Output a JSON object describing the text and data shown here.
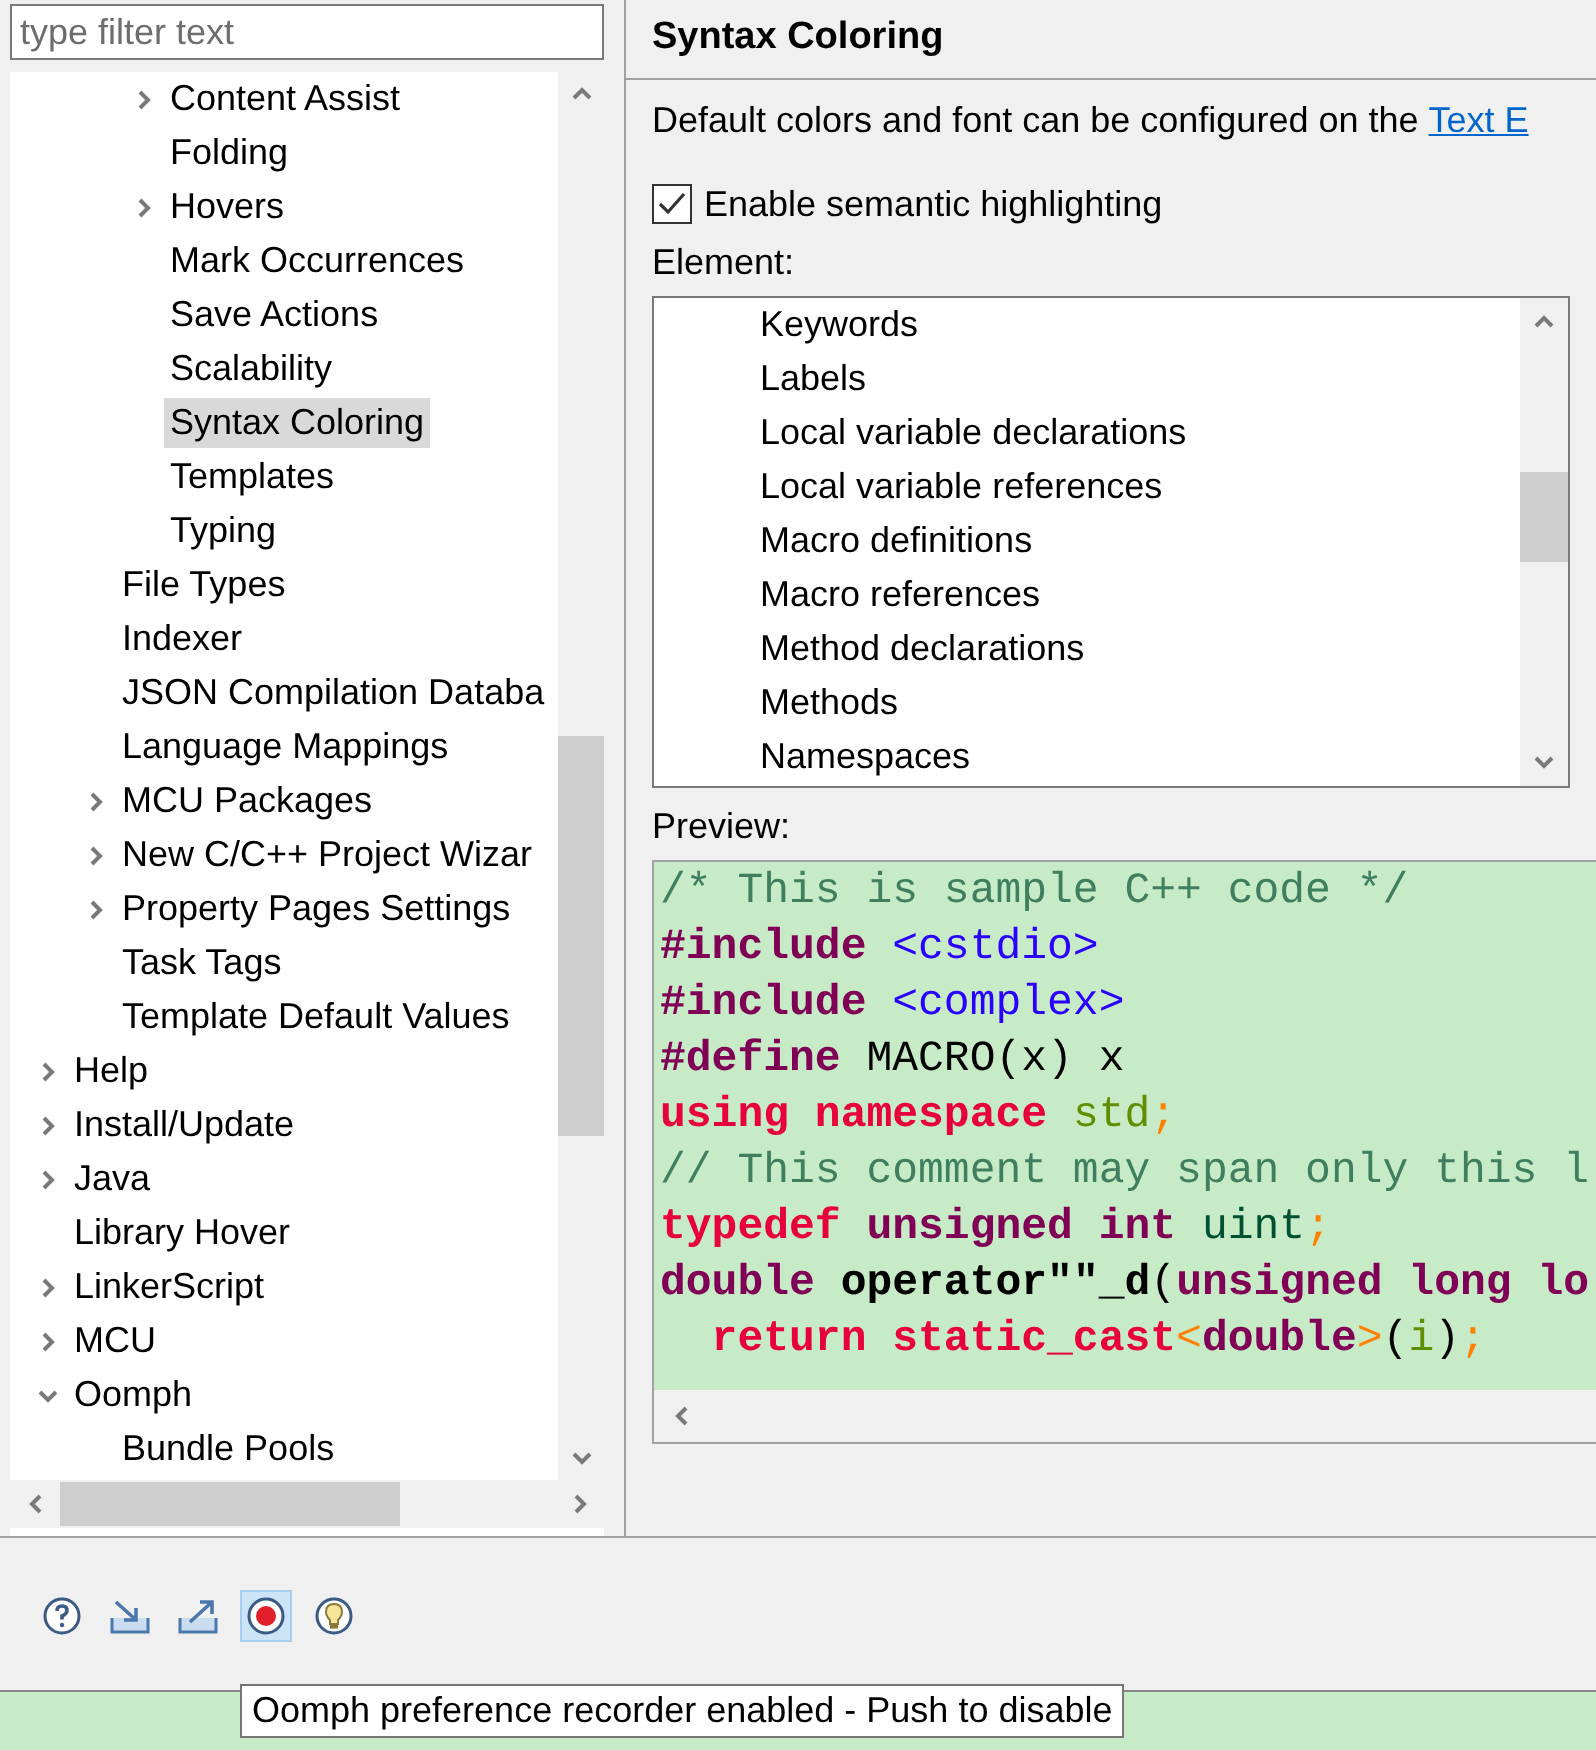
{
  "filter": {
    "placeholder": "type filter text"
  },
  "tree": [
    {
      "children": [
        {
          "children": [
            {
              "label": "Content Assist",
              "expanded": false,
              "selected": false
            },
            {
              "label": "Folding",
              "selected": false
            },
            {
              "label": "Hovers",
              "expanded": false,
              "selected": false
            },
            {
              "label": "Mark Occurrences",
              "selected": false
            },
            {
              "label": "Save Actions",
              "selected": false
            },
            {
              "label": "Scalability",
              "selected": false
            },
            {
              "label": "Syntax Coloring",
              "selected": true
            },
            {
              "label": "Templates",
              "selected": false
            },
            {
              "label": "Typing",
              "selected": false
            }
          ]
        },
        {
          "label": "File Types",
          "selected": false
        },
        {
          "label": "Indexer",
          "selected": false
        },
        {
          "label": "JSON Compilation Databa",
          "selected": false
        },
        {
          "label": "Language Mappings",
          "selected": false
        },
        {
          "label": "MCU Packages",
          "expanded": false,
          "selected": false
        },
        {
          "label": "New C/C++ Project Wizar",
          "expanded": false,
          "selected": false
        },
        {
          "label": "Property Pages Settings",
          "expanded": false,
          "selected": false
        },
        {
          "label": "Task Tags",
          "selected": false
        },
        {
          "label": "Template Default Values",
          "selected": false
        }
      ]
    },
    {
      "label": "Help",
      "expanded": false,
      "selected": false
    },
    {
      "label": "Install/Update",
      "expanded": false,
      "selected": false
    },
    {
      "label": "Java",
      "expanded": false,
      "selected": false
    },
    {
      "label": "Library Hover",
      "selected": false
    },
    {
      "label": "LinkerScript",
      "expanded": false,
      "selected": false
    },
    {
      "label": "MCU",
      "expanded": false,
      "selected": false
    },
    {
      "label": "Oomph",
      "expanded": true,
      "selected": false,
      "children": [
        {
          "label": "Bundle Pools",
          "selected": false
        }
      ]
    }
  ],
  "page": {
    "title": "Syntax Coloring",
    "description": "Default colors and font can be configured on the",
    "link": "Text E",
    "semantic": {
      "label": "Enable semantic highlighting",
      "checked": true
    },
    "element_label": "Element:",
    "elements": [
      {
        "label": "Keywords"
      },
      {
        "label": "Labels"
      },
      {
        "label": "Local variable declarations"
      },
      {
        "label": "Local variable references"
      },
      {
        "label": "Macro definitions"
      },
      {
        "label": "Macro references"
      },
      {
        "label": "Method declarations"
      },
      {
        "label": "Methods"
      },
      {
        "label": "Namespaces"
      }
    ],
    "preview_label": "Preview:",
    "preview": [
      [
        {
          "t": "/* This is sample C++ code */",
          "kind": "comment"
        }
      ],
      [
        {
          "t": "#include",
          "kind": "directive"
        },
        {
          "t": " <cstdio>",
          "kind": "string"
        }
      ],
      [
        {
          "t": "#include",
          "kind": "directive"
        },
        {
          "t": " <complex>",
          "kind": "string"
        }
      ],
      [
        {
          "t": "#define",
          "kind": "directive"
        },
        {
          "t": " MACRO(x) x",
          "kind": "plain"
        }
      ],
      [
        {
          "t": "using namespace",
          "kind": "keyword"
        },
        {
          "t": " std",
          "kind": "name"
        },
        {
          "t": ";",
          "kind": "operator"
        }
      ],
      [
        {
          "t": "// This comment may span only this l",
          "kind": "comment"
        }
      ],
      [
        {
          "t": "typedef",
          "kind": "keyword"
        },
        {
          "t": " unsigned int",
          "kind": "type"
        },
        {
          "t": " uint",
          "kind": "typedef"
        },
        {
          "t": ";",
          "kind": "operator"
        }
      ],
      [
        {
          "t": "double",
          "kind": "type"
        },
        {
          "t": " operator\"\"_d",
          "kind": "function"
        },
        {
          "t": "(",
          "kind": "plain"
        },
        {
          "t": "unsigned long lo",
          "kind": "type"
        }
      ],
      [
        {
          "t": "  return",
          "kind": "keyword"
        },
        {
          "t": " static_cast",
          "kind": "keyword"
        },
        {
          "t": "<",
          "kind": "operator"
        },
        {
          "t": "double",
          "kind": "type"
        },
        {
          "t": ">",
          "kind": "operator"
        },
        {
          "t": "(",
          "kind": "plain"
        },
        {
          "t": "i",
          "kind": "name"
        },
        {
          "t": ")",
          "kind": "plain"
        },
        {
          "t": ";",
          "kind": "operator"
        }
      ]
    ]
  },
  "toolbar": [
    {
      "kind": "help",
      "pressed": false
    },
    {
      "kind": "import",
      "pressed": false
    },
    {
      "kind": "export",
      "pressed": false
    },
    {
      "kind": "record",
      "pressed": true
    },
    {
      "kind": "tip",
      "pressed": false
    }
  ],
  "tooltip": "Oomph preference recorder enabled - Push to disable"
}
